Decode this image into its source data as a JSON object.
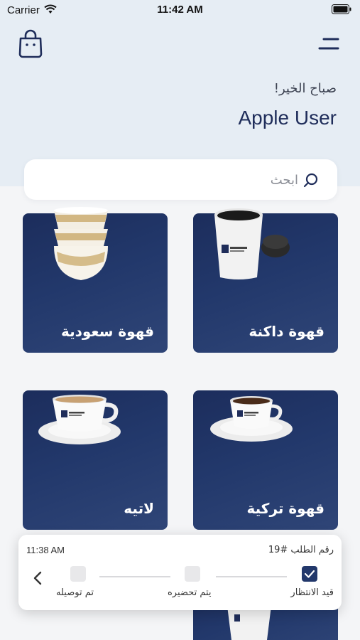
{
  "status_bar": {
    "carrier": "Carrier",
    "time": "11:42 AM"
  },
  "header": {
    "greeting": "صباح الخير!",
    "user_name": "Apple User"
  },
  "search": {
    "placeholder": "ابحث"
  },
  "categories": [
    {
      "title": "قهوة داكنة"
    },
    {
      "title": "قهوة سعودية"
    },
    {
      "title": "قهوة تركية"
    },
    {
      "title": "لاتيه"
    }
  ],
  "order_status": {
    "order_number": "رقم الطلب #19",
    "time": "11:38 AM",
    "steps": [
      {
        "label": "قيد الانتظار",
        "done": true
      },
      {
        "label": "يتم تحضيره",
        "done": false
      },
      {
        "label": "تم توصيله",
        "done": false
      }
    ]
  },
  "colors": {
    "primary": "#1f2d5a",
    "card": "#22386b",
    "background": "#e6edf4"
  }
}
